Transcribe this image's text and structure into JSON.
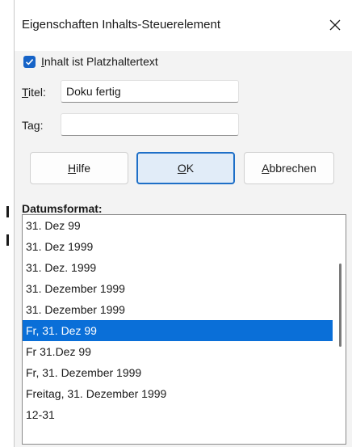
{
  "window": {
    "title": "Eigenschaften Inhalts-Steuerelement",
    "close_label": "✕"
  },
  "placeholder_checkbox": {
    "checked": true,
    "mnemonic": "I",
    "label_rest": "nhalt ist Platzhaltertext"
  },
  "title_field": {
    "mnemonic": "T",
    "label_rest": "itel:",
    "value": "Doku fertig"
  },
  "tag_field": {
    "label_pre": "Ta",
    "mnemonic": "g",
    "label_post": ":",
    "value": ""
  },
  "buttons": {
    "help": {
      "mnemonic": "H",
      "label_rest": "ilfe"
    },
    "ok": {
      "mnemonic": "O",
      "label_rest": "K"
    },
    "cancel": {
      "mnemonic": "A",
      "label_rest": "bbrechen"
    }
  },
  "date_format": {
    "label": "Datumsformat:",
    "selected_index": 5,
    "items": [
      "31. Dez 99",
      "31. Dez 1999",
      "31. Dez. 1999",
      "31. Dezember 1999",
      "31. Dezember 1999",
      "Fr, 31. Dez 99",
      "Fr 31.Dez 99",
      "Fr, 31. Dezember 1999",
      "Freitag, 31. Dezember 1999",
      "12-31"
    ]
  },
  "colors": {
    "accent": "#1e6fc7",
    "selection": "#0a6fd8",
    "checkbox": "#1663c7",
    "dialog_background": "#f3f3f3"
  },
  "icons": {
    "close": "close-icon",
    "checkbox": "checkmark-icon"
  }
}
